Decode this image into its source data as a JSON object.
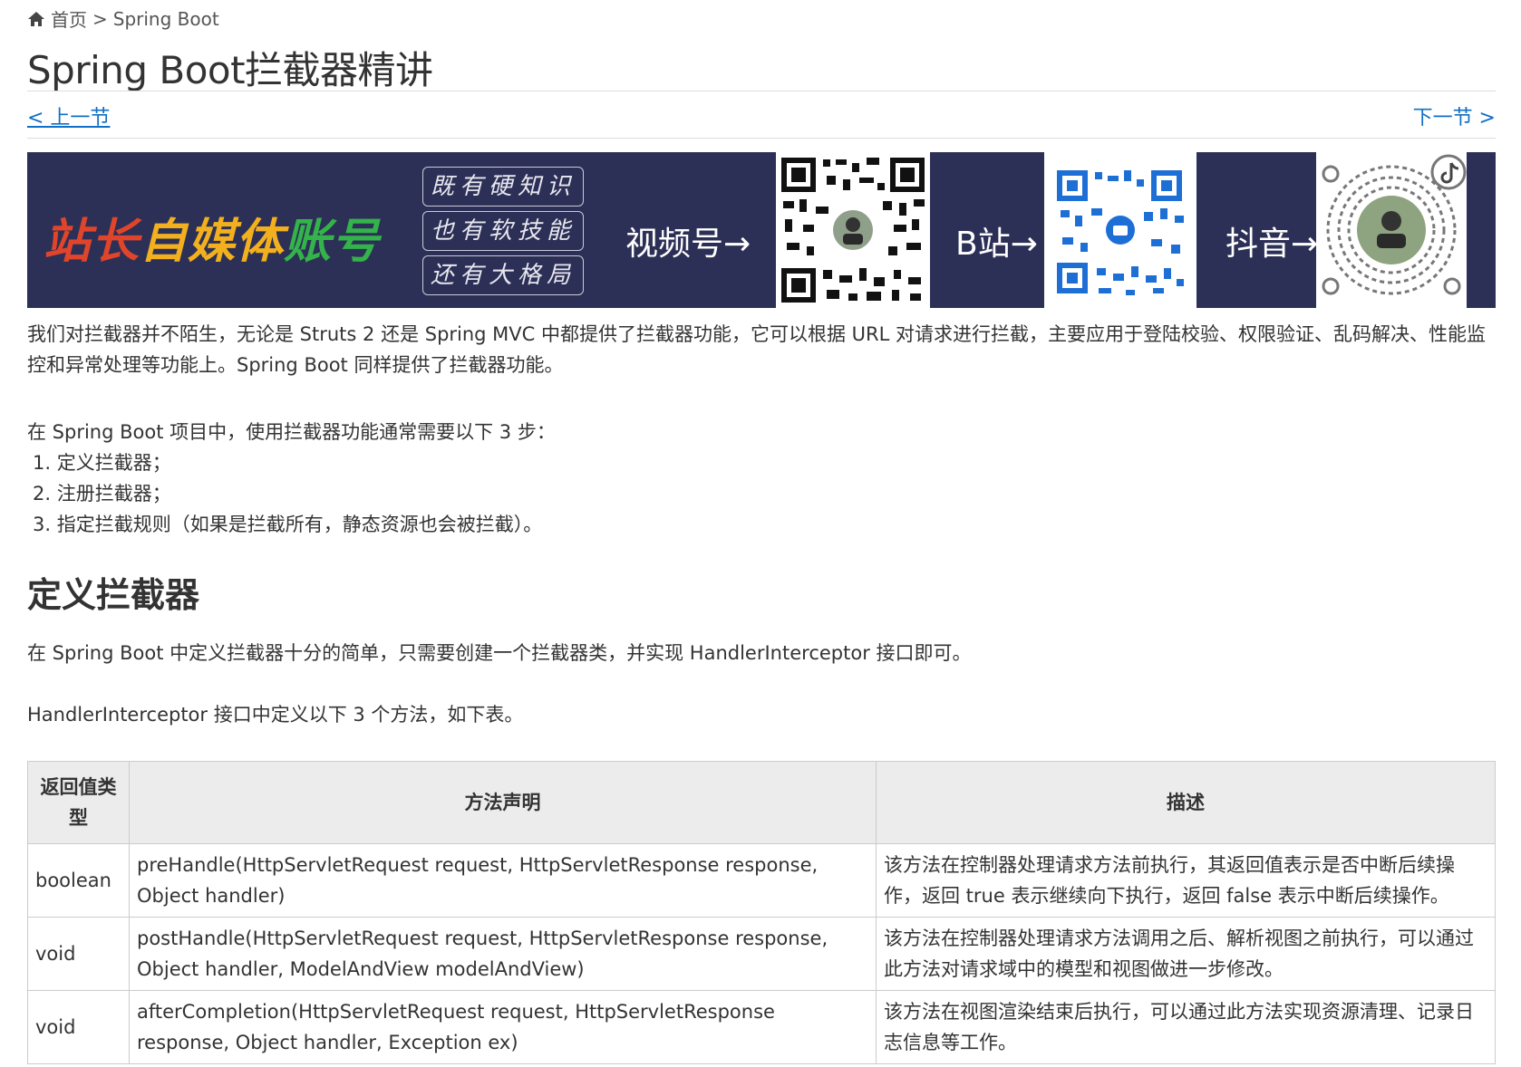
{
  "breadcrumb": {
    "home": "首页",
    "separator": ">",
    "current": "Spring Boot",
    "icon": "home-icon"
  },
  "title": "Spring Boot拦截器精讲",
  "nav": {
    "prev": "< 上一节",
    "next": "下一节 >"
  },
  "banner": {
    "brand_part1": "站长",
    "brand_part2": "自媒体",
    "brand_part3": "账号",
    "slogans": [
      "既有硬知识",
      "也有软技能",
      "还有大格局"
    ],
    "labels": [
      "视频号→",
      "B站→",
      "抖音→"
    ],
    "colors": {
      "background": "#2d3056",
      "red": "#e0452b",
      "yellow": "#f2b01e",
      "green": "#33b34a"
    }
  },
  "intro": "我们对拦截器并不陌生，无论是 Struts 2 还是 Spring MVC 中都提供了拦截器功能，它可以根据 URL 对请求进行拦截，主要应用于登陆校验、权限验证、乱码解决、性能监控和异常处理等功能上。Spring Boot 同样提供了拦截器功能。",
  "steps_intro": "在 Spring Boot 项目中，使用拦截器功能通常需要以下 3 步：",
  "steps": [
    "1. 定义拦截器；",
    "2. 注册拦截器；",
    "3. 指定拦截规则（如果是拦截所有，静态资源也会被拦截）。"
  ],
  "section_heading": "定义拦截器",
  "section_text1": "在 Spring Boot 中定义拦截器十分的简单，只需要创建一个拦截器类，并实现 HandlerInterceptor 接口即可。",
  "section_text2": "HandlerInterceptor  接口中定义以下 3 个方法，如下表。",
  "table": {
    "headers": [
      "返回值类型",
      "方法声明",
      "描述"
    ],
    "rows": [
      [
        "boolean",
        "preHandle(HttpServletRequest request, HttpServletResponse response, Object handler)",
        "该方法在控制器处理请求方法前执行，其返回值表示是否中断后续操作，返回 true 表示继续向下执行，返回 false 表示中断后续操作。"
      ],
      [
        "void",
        "postHandle(HttpServletRequest request, HttpServletResponse response, Object handler, ModelAndView modelAndView)",
        "该方法在控制器处理请求方法调用之后、解析视图之前执行，可以通过此方法对请求域中的模型和视图做进一步修改。"
      ],
      [
        "void",
        "afterCompletion(HttpServletRequest request, HttpServletResponse response, Object handler, Exception ex)",
        "该方法在视图渲染结束后执行，可以通过此方法实现资源清理、记录日志信息等工作。"
      ]
    ]
  },
  "colors": {
    "link": "#0f6fc6",
    "text": "#333333",
    "table_header_bg": "#ececec"
  }
}
